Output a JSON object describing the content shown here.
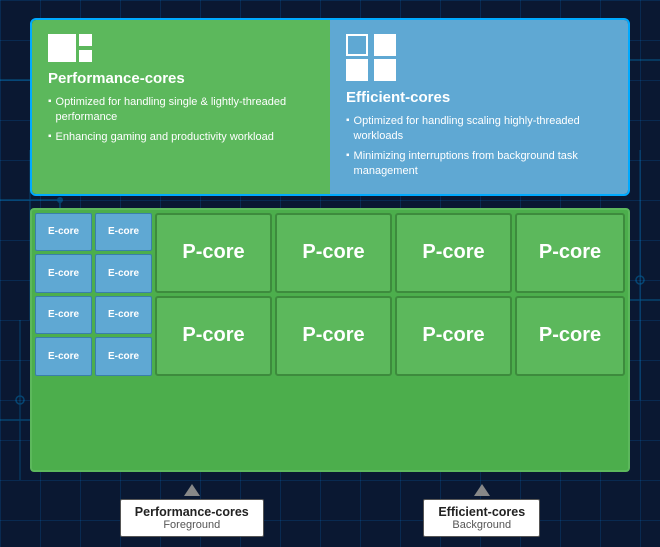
{
  "background": {
    "color": "#0a1832"
  },
  "top_section": {
    "p_cores": {
      "label": "Performance-cores",
      "bullet1": "Optimized for handling single & lightly-threaded performance",
      "bullet2": "Enhancing gaming and productivity workload"
    },
    "e_cores": {
      "label": "Efficient-cores",
      "bullet1": "Optimized for handling scaling highly-threaded workloads",
      "bullet2": "Minimizing interruptions from background task management"
    }
  },
  "chip": {
    "p_core_label": "P-core",
    "e_core_label": "E-core",
    "p_cores": [
      "P-core",
      "P-core",
      "P-core",
      "P-core",
      "P-core",
      "P-core",
      "P-core",
      "P-core"
    ],
    "e_cores": [
      "E-core",
      "E-core",
      "E-core",
      "E-core",
      "E-core",
      "E-core",
      "E-core",
      "E-core"
    ]
  },
  "bottom_labels": {
    "p_cores": {
      "title": "Performance-cores",
      "subtitle": "Foreground"
    },
    "e_cores": {
      "title": "Efficient-cores",
      "subtitle": "Background"
    }
  }
}
